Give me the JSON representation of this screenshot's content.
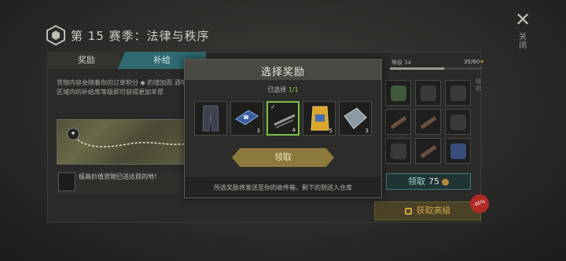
{
  "header": {
    "season_title": "第 15 赛季：法律与秩序",
    "close_label": "关闭"
  },
  "tabs": [
    {
      "label": "奖励"
    },
    {
      "label": "补给"
    }
  ],
  "info": {
    "text": "货物内容会随着你的订单积分 ◆ 的增加而 酒吧区域内的补给库等级即可获得更加丰厚",
    "tip": "极高价值货物已送达目的地！"
  },
  "level": {
    "label": "等级 34",
    "progress": "35/60",
    "progress_fraction": 0.583
  },
  "right_side_text": "随机",
  "claim_count": {
    "label": "领取",
    "value": "75"
  },
  "premium": {
    "label": "获取高级",
    "discount": "-60%"
  },
  "modal": {
    "title": "选择奖励",
    "selected_prefix": "已选择 ",
    "selected_count": "1/1",
    "items": [
      {
        "name": "tactical-pants",
        "qty": ""
      },
      {
        "name": "circuit-board",
        "qty": "3"
      },
      {
        "name": "pipes",
        "qty": "4",
        "selected": true
      },
      {
        "name": "snack-bag",
        "qty": "5"
      },
      {
        "name": "metal-plate",
        "qty": "3"
      }
    ],
    "claim_label": "领取",
    "footer": "所选奖励将发送至你的收件箱，剩下的则送入仓库"
  },
  "colors": {
    "accent_teal": "#2f6a70",
    "selected_green": "#7fc04a",
    "gold": "#8c7a3d",
    "badge_red": "#b12a26"
  }
}
